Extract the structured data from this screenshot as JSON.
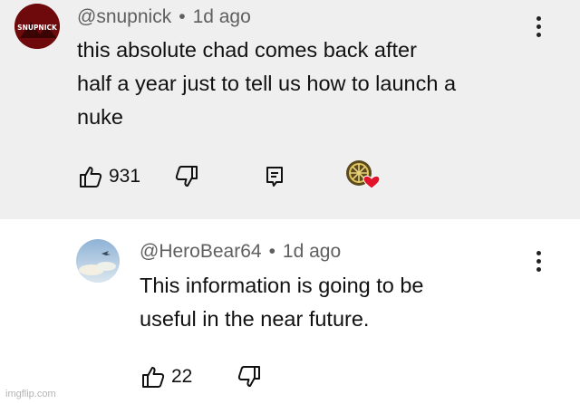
{
  "comments": [
    {
      "username": "@snupnick",
      "separator": "•",
      "time": "1d ago",
      "text": "this absolute chad comes back after\nhalf a year just to tell us how to launch a\nnuke",
      "like_count": "931",
      "avatar_text": "SNUPNICK",
      "heart_badge": true
    },
    {
      "username": "@HeroBear64",
      "separator": "•",
      "time": "1d ago",
      "text": "This information is going to be\nuseful in the near future.",
      "like_count": "22"
    }
  ],
  "watermark": "imgflip.com",
  "colors": {
    "top_bg": "#efefef",
    "reply_bg": "#ffffff",
    "heart": "#e0132b",
    "meta": "#5f5f5f"
  }
}
